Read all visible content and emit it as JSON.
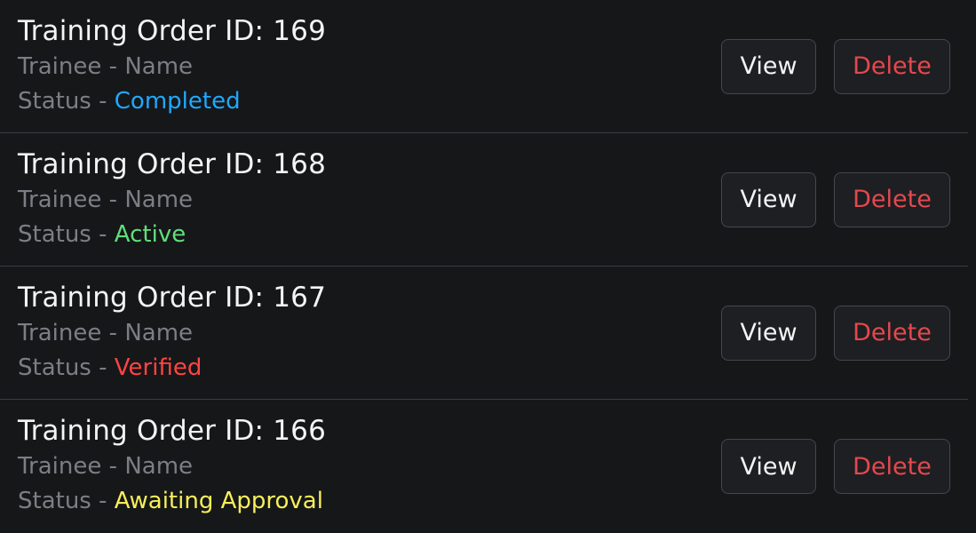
{
  "orders": [
    {
      "title": "Training Order ID: 169",
      "trainee_label": "Trainee",
      "trainee_sep": " - ",
      "trainee_value": "Name",
      "status_label": "Status",
      "status_sep": " - ",
      "status_value": "Completed",
      "status_color": "#1fa8ff",
      "view_label": "View",
      "delete_label": "Delete"
    },
    {
      "title": "Training Order ID: 168",
      "trainee_label": "Trainee",
      "trainee_sep": " - ",
      "trainee_value": "Name",
      "status_label": "Status",
      "status_sep": " - ",
      "status_value": "Active",
      "status_color": "#5fe07a",
      "view_label": "View",
      "delete_label": "Delete"
    },
    {
      "title": "Training Order ID: 167",
      "trainee_label": "Trainee",
      "trainee_sep": " - ",
      "trainee_value": "Name",
      "status_label": "Status",
      "status_sep": " - ",
      "status_value": "Verified",
      "status_color": "#ff4444",
      "view_label": "View",
      "delete_label": "Delete"
    },
    {
      "title": "Training Order ID: 166",
      "trainee_label": "Trainee",
      "trainee_sep": " - ",
      "trainee_value": "Name",
      "status_label": "Status",
      "status_sep": " - ",
      "status_value": "Awaiting Approval",
      "status_color": "#f6ef5a",
      "view_label": "View",
      "delete_label": "Delete"
    }
  ]
}
